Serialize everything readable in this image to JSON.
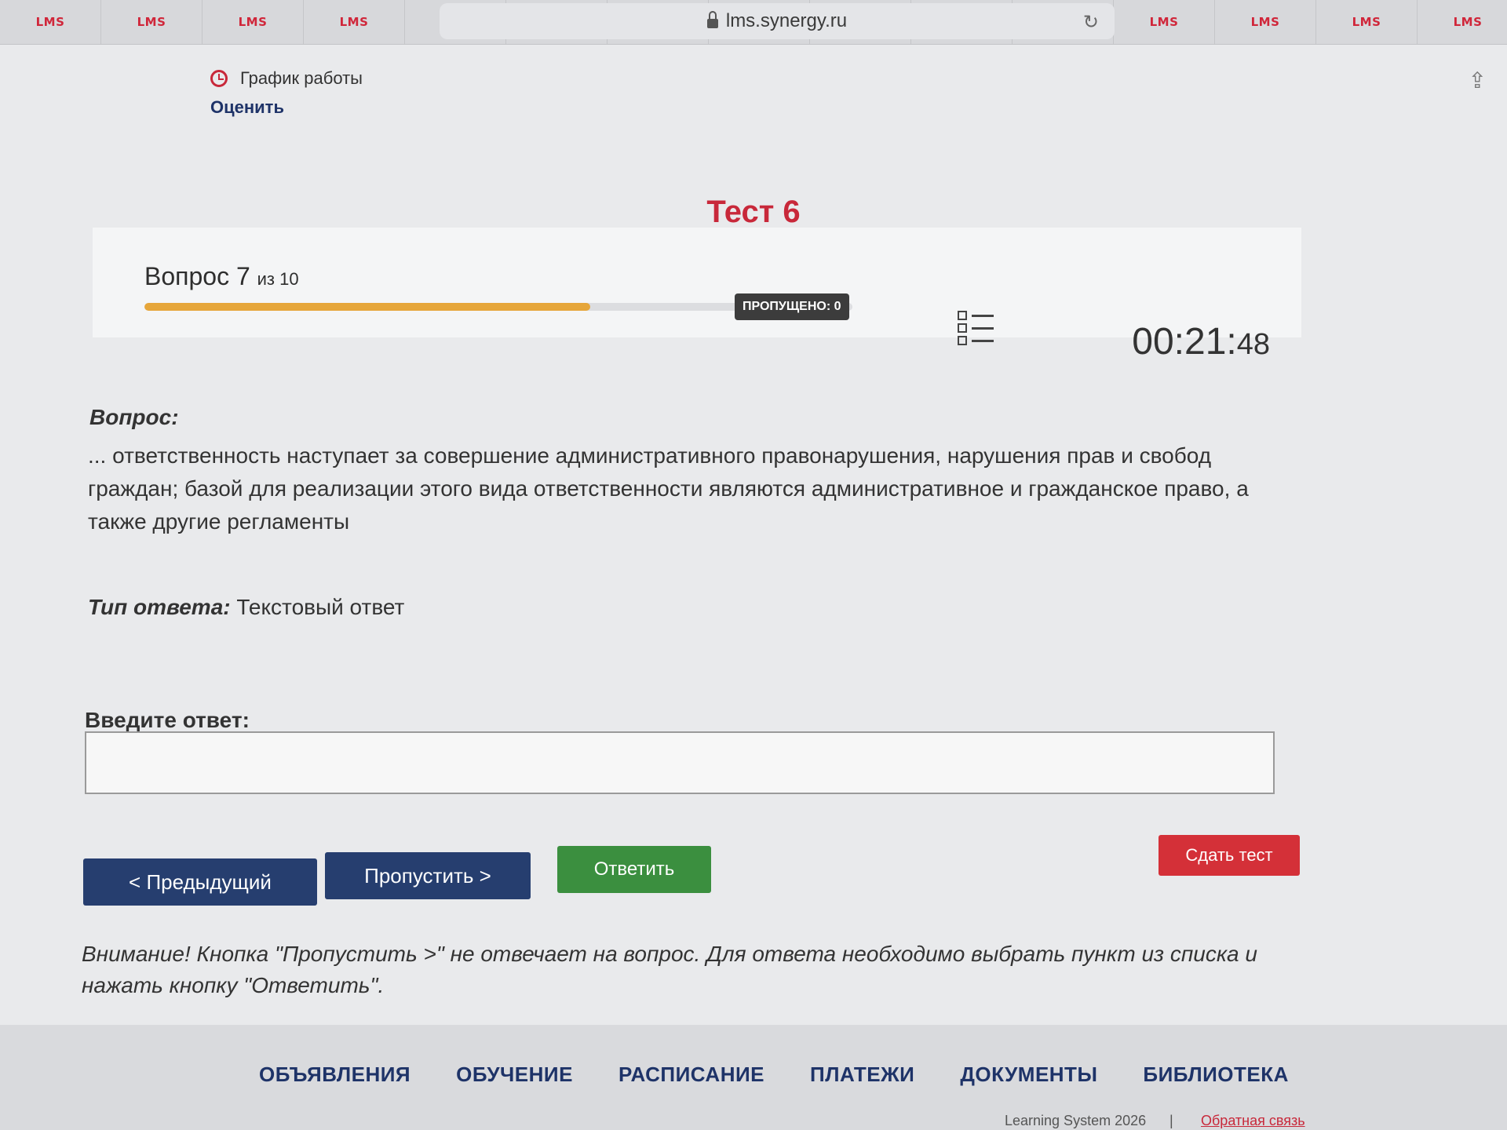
{
  "browser": {
    "tab_label": "LMS",
    "tab_count": 15,
    "url": "lms.synergy.ru"
  },
  "top_menu": {
    "schedule_label": "График работы",
    "rate_label": "Оценить"
  },
  "test": {
    "title": "Тест 6",
    "question_word": "Вопрос",
    "question_number": "7",
    "question_of": "из 10",
    "progress_fraction": 0.63,
    "skipped_label": "ПРОПУЩЕНО: 0",
    "timer_main": "00:21:",
    "timer_sec": "48"
  },
  "question": {
    "heading": "Вопрос:",
    "text": "... ответственность наступает за совершение административного правонарушения, нарушения прав и свобод граждан; базой для реализации этого вида ответственности являются административное и гражданское право, а также другие регламенты",
    "answer_type_label": "Тип ответа:",
    "answer_type_value": "Текстовый ответ"
  },
  "answer": {
    "label": "Введите ответ:",
    "value": ""
  },
  "buttons": {
    "prev": "< Предыдущий",
    "skip": "Пропустить >",
    "answer": "Ответить",
    "submit": "Сдать тест"
  },
  "warning": "Внимание! Кнопка \"Пропустить >\" не отвечает на вопрос. Для ответа необходимо выбрать пункт из списка и нажать кнопку \"Ответить\".",
  "footer": {
    "nav": [
      "ОБЪЯВЛЕНИЯ",
      "ОБУЧЕНИЕ",
      "РАСПИСАНИЕ",
      "ПЛАТЕЖИ",
      "ДОКУМЕНТЫ",
      "БИБЛИОТЕКА"
    ],
    "copyright": "Learning System 2026",
    "separator": "|",
    "feedback": "Обратная связь"
  },
  "colors": {
    "brand_red": "#c8283a",
    "nav_blue": "#263e6f",
    "answer_green": "#3b8f3f",
    "progress_orange": "#e6a63a"
  }
}
